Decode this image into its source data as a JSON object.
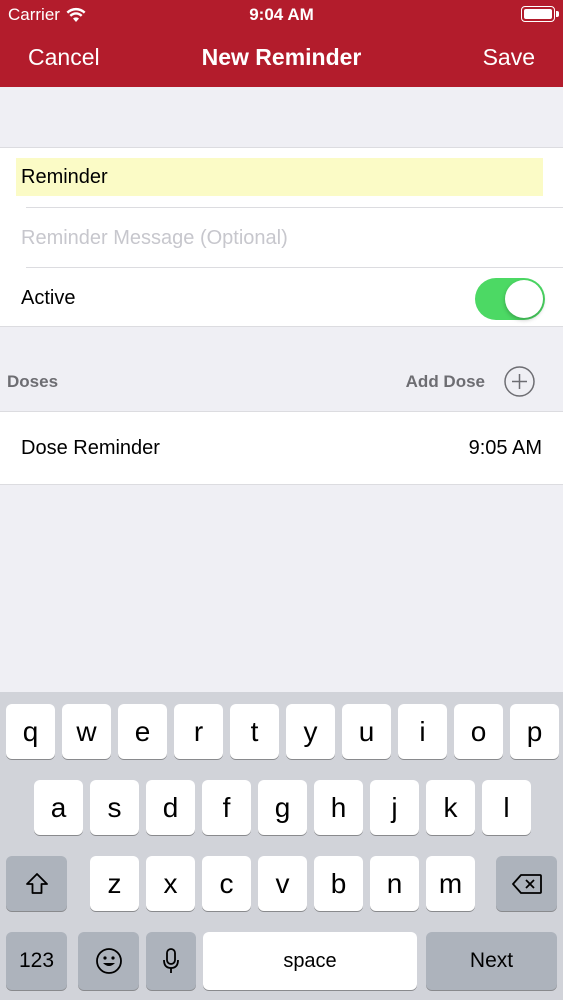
{
  "status_bar": {
    "carrier": "Carrier",
    "time": "9:04 AM"
  },
  "nav": {
    "cancel_label": "Cancel",
    "title": "New Reminder",
    "save_label": "Save"
  },
  "form": {
    "name_value": "Reminder",
    "message_placeholder": "Reminder Message (Optional)",
    "active_label": "Active",
    "active_on": true
  },
  "doses": {
    "section_title": "Doses",
    "add_label": "Add Dose",
    "items": [
      {
        "label": "Dose Reminder",
        "time": "9:05 AM"
      }
    ]
  },
  "keyboard": {
    "row1": [
      "q",
      "w",
      "e",
      "r",
      "t",
      "y",
      "u",
      "i",
      "o",
      "p"
    ],
    "row2": [
      "a",
      "s",
      "d",
      "f",
      "g",
      "h",
      "j",
      "k",
      "l"
    ],
    "row3": [
      "z",
      "x",
      "c",
      "v",
      "b",
      "n",
      "m"
    ],
    "numbers_label": "123",
    "space_label": "space",
    "next_label": "Next"
  },
  "colors": {
    "brand": "#b31c2c",
    "toggle_on": "#4cd964",
    "field_highlight": "#fbfbc6"
  }
}
